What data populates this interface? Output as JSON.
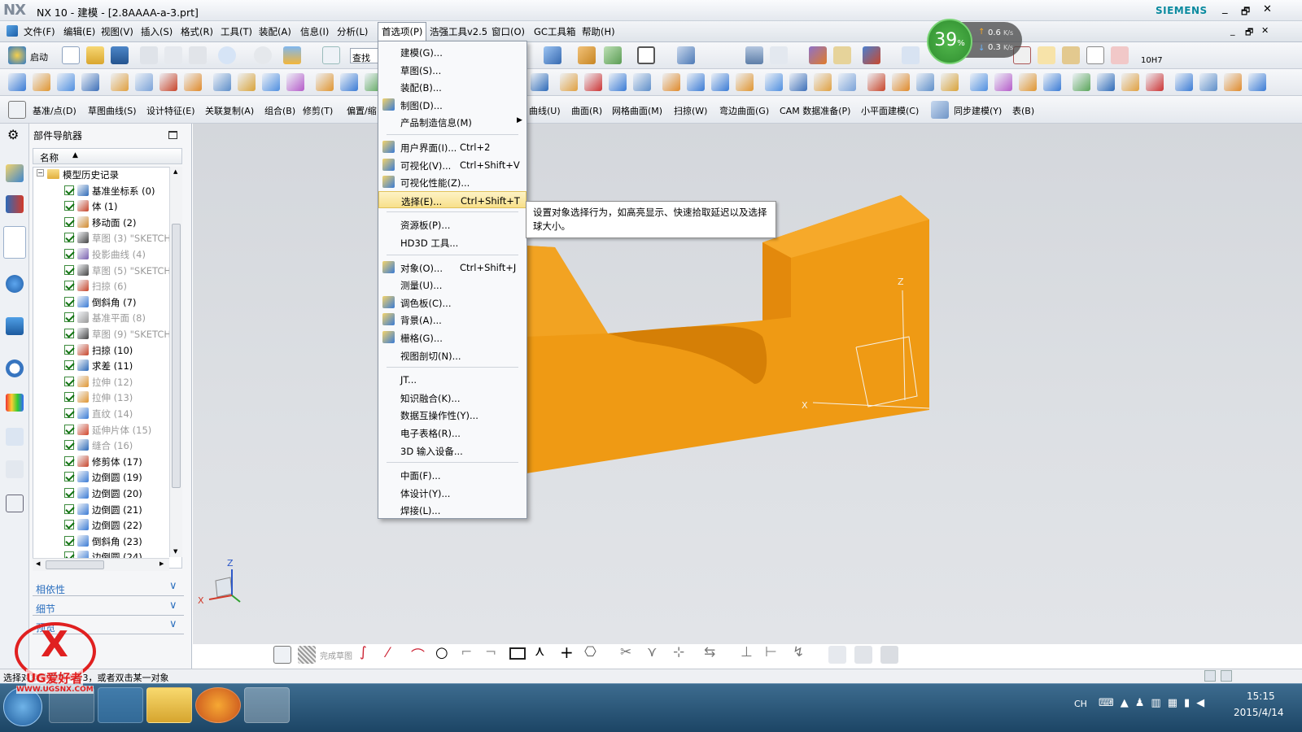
{
  "window": {
    "logo": "NX",
    "title": "NX 10 - 建模 - [2.8AAAA-a-3.prt]",
    "brand": "SIEMENS",
    "controls": [
      "_",
      "🗗",
      "✕"
    ]
  },
  "menubar": {
    "items": [
      "文件(F)",
      "编辑(E)",
      "视图(V)",
      "插入(S)",
      "格式(R)",
      "工具(T)",
      "装配(A)",
      "信息(I)",
      "分析(L)",
      "首选项(P)",
      "浩强工具v2.5",
      "窗口(O)",
      "GC工具箱",
      "帮助(H)"
    ],
    "active": "首选项(P)"
  },
  "toolbar1": {
    "start_label": "启动",
    "find_label": "查找命",
    "command_label": "10H7"
  },
  "toolbar3": {
    "left_items": [
      "基准/点(D)",
      "草图曲线(S)",
      "设计特征(E)",
      "关联复制(A)",
      "组合(B)",
      "修剪(T)",
      "偏置/缩"
    ],
    "right_items": [
      "曲线(U)",
      "曲面(R)",
      "网格曲面(M)",
      "扫掠(W)",
      "弯边曲面(G)",
      "CAM 数据准备(P)",
      "小平面建模(C)",
      "同步建模(Y)",
      "表(B)"
    ]
  },
  "speed_widget": {
    "percent": "39",
    "percent_sign": "%",
    "up": "0.6",
    "up_unit": "K/s",
    "down": "0.3",
    "down_unit": "K/s"
  },
  "navigator": {
    "title": "部件导航器",
    "column_header": "名称",
    "root": "模型历史记录",
    "items": [
      {
        "label": "基准坐标系 (0)",
        "dim": false,
        "color": "#2d6ab8"
      },
      {
        "label": "体 (1)",
        "dim": false,
        "color": "#c8452a"
      },
      {
        "label": "移动面 (2)",
        "dim": false,
        "color": "#d28a2c"
      },
      {
        "label": "草图 (3) \"SKETCH_",
        "dim": true,
        "color": "#444444"
      },
      {
        "label": "投影曲线 (4)",
        "dim": true,
        "color": "#7a5fb0"
      },
      {
        "label": "草图 (5) \"SKETCH_",
        "dim": true,
        "color": "#444444"
      },
      {
        "label": "扫掠 (6)",
        "dim": true,
        "color": "#c8452a"
      },
      {
        "label": "倒斜角 (7)",
        "dim": false,
        "color": "#3a7bd5"
      },
      {
        "label": "基准平面 (8)",
        "dim": true,
        "color": "#999999"
      },
      {
        "label": "草图 (9) \"SKETCH_",
        "dim": true,
        "color": "#444444"
      },
      {
        "label": "扫掠 (10)",
        "dim": false,
        "color": "#c8452a"
      },
      {
        "label": "求差 (11)",
        "dim": false,
        "color": "#2d6ab8"
      },
      {
        "label": "拉伸 (12)",
        "dim": true,
        "color": "#e09530"
      },
      {
        "label": "拉伸 (13)",
        "dim": true,
        "color": "#e09530"
      },
      {
        "label": "直纹 (14)",
        "dim": true,
        "color": "#3a7bd5"
      },
      {
        "label": "延伸片体 (15)",
        "dim": true,
        "color": "#d2452a"
      },
      {
        "label": "缝合 (16)",
        "dim": true,
        "color": "#2d6ab8"
      },
      {
        "label": "修剪体 (17)",
        "dim": false,
        "color": "#c8452a"
      },
      {
        "label": "边倒圆 (19)",
        "dim": false,
        "color": "#3a7bd5"
      },
      {
        "label": "边倒圆 (20)",
        "dim": false,
        "color": "#3a7bd5"
      },
      {
        "label": "边倒圆 (21)",
        "dim": false,
        "color": "#3a7bd5"
      },
      {
        "label": "边倒圆 (22)",
        "dim": false,
        "color": "#3a7bd5"
      },
      {
        "label": "倒斜角 (23)",
        "dim": false,
        "color": "#3a7bd5"
      },
      {
        "label": "边倒圆 (24)",
        "dim": false,
        "color": "#3a7bd5"
      }
    ],
    "sections": [
      "相依性",
      "细节",
      "预览"
    ]
  },
  "dropdown": {
    "items": [
      {
        "label": "建模(G)...",
        "shortcut": "",
        "icon": "none"
      },
      {
        "label": "草图(S)...",
        "shortcut": "",
        "icon": "none"
      },
      {
        "label": "装配(B)...",
        "shortcut": "",
        "icon": "none"
      },
      {
        "label": "制图(D)...",
        "shortcut": "",
        "icon": "drafting-icon"
      },
      {
        "label": "产品制造信息(M)",
        "shortcut": "",
        "icon": "none",
        "submenu": true
      },
      {
        "sep": true
      },
      {
        "label": "用户界面(I)...",
        "shortcut": "Ctrl+2",
        "icon": "user-interface-icon"
      },
      {
        "label": "可视化(V)...",
        "shortcut": "Ctrl+Shift+V",
        "icon": "visualization-icon"
      },
      {
        "label": "可视化性能(Z)...",
        "shortcut": "",
        "icon": "visualization-performance-icon"
      },
      {
        "label": "选择(E)...",
        "shortcut": "Ctrl+Shift+T",
        "icon": "none",
        "highlight": true
      },
      {
        "sep": true
      },
      {
        "label": "资源板(P)...",
        "shortcut": "",
        "icon": "none"
      },
      {
        "label": "HD3D 工具...",
        "shortcut": "",
        "icon": "none"
      },
      {
        "sep": true
      },
      {
        "label": "对象(O)...",
        "shortcut": "Ctrl+Shift+J",
        "icon": "object-icon"
      },
      {
        "label": "测量(U)...",
        "shortcut": "",
        "icon": "none"
      },
      {
        "label": "调色板(C)...",
        "shortcut": "",
        "icon": "palette-icon"
      },
      {
        "label": "背景(A)...",
        "shortcut": "",
        "icon": "background-icon"
      },
      {
        "label": "栅格(G)...",
        "shortcut": "",
        "icon": "grid-icon"
      },
      {
        "label": "视图剖切(N)...",
        "shortcut": "",
        "icon": "none"
      },
      {
        "sep": true
      },
      {
        "label": "JT...",
        "shortcut": "",
        "icon": "none"
      },
      {
        "label": "知识融合(K)...",
        "shortcut": "",
        "icon": "none"
      },
      {
        "label": "数据互操作性(Y)...",
        "shortcut": "",
        "icon": "none"
      },
      {
        "label": "电子表格(R)...",
        "shortcut": "",
        "icon": "none"
      },
      {
        "label": "3D 输入设备...",
        "shortcut": "",
        "icon": "none"
      },
      {
        "sep": true
      },
      {
        "label": "中面(F)...",
        "shortcut": "",
        "icon": "none"
      },
      {
        "label": "体设计(Y)...",
        "shortcut": "",
        "icon": "none"
      },
      {
        "label": "焊接(L)...",
        "shortcut": "",
        "icon": "none"
      }
    ]
  },
  "tooltip": {
    "text": "设置对象选择行为，如高亮显示、快速拾取延迟以及选择球大小。"
  },
  "viewport": {
    "axis_x": "X",
    "axis_z": "Z",
    "triad_x": "X",
    "triad_z": "Z",
    "model_color": "#ef9a14"
  },
  "sketch_toolbar": {
    "finish_label": "完成草图"
  },
  "statusbar": {
    "message": "选择对象并使用 MB3，或者双击某一对象"
  },
  "taskbar": {
    "lang": "CH",
    "time": "15:15",
    "date": "2015/4/14"
  },
  "watermark": {
    "brand": "UG爱好者",
    "url": "WWW.UGSNX.COM"
  }
}
